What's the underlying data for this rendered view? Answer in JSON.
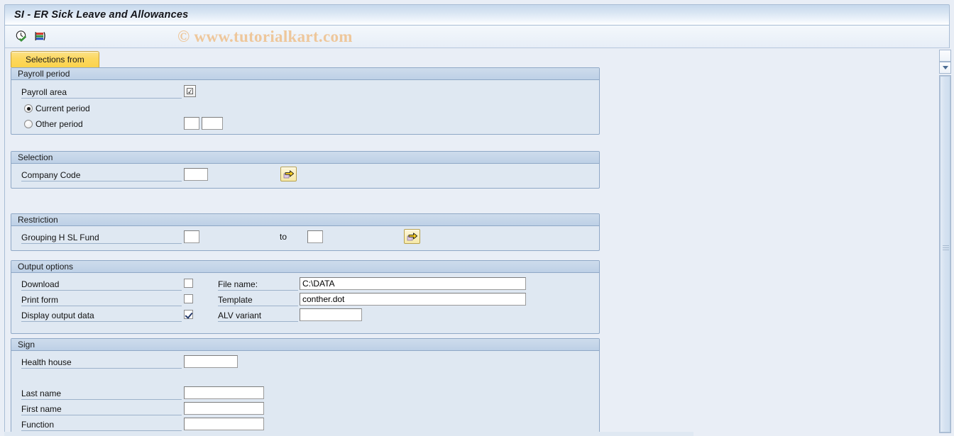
{
  "window": {
    "title": "SI - ER Sick Leave and Allowances"
  },
  "watermark": {
    "text": "© www.tutorialkart.com"
  },
  "toolbar": {
    "icons": [
      {
        "name": "execute-clock-icon",
        "title": "Execute"
      },
      {
        "name": "variant-bars-icon",
        "title": "Get Variant"
      }
    ]
  },
  "tabs": [
    {
      "label": "Selections from",
      "active": true
    }
  ],
  "groups": {
    "payroll_period": {
      "title": "Payroll period",
      "payroll_area_label": "Payroll area",
      "payroll_area_value": "",
      "matchcode_glyph": "☑",
      "current_period_label": "Current period",
      "other_period_label": "Other period",
      "current_period_selected": true,
      "other_period_value_1": "",
      "other_period_value_2": ""
    },
    "selection": {
      "title": "Selection",
      "company_code_label": "Company Code",
      "company_code_value": "",
      "multi_select_icon": "multi-select-arrow-icon"
    },
    "restriction": {
      "title": "Restriction",
      "grouping_label": "Grouping H SL Fund",
      "grouping_from_value": "",
      "to_label": "to",
      "grouping_to_value": "",
      "multi_select_icon": "multi-select-arrow-icon"
    },
    "output_options": {
      "title": "Output options",
      "download_label": "Download",
      "download_checked": false,
      "print_form_label": "Print form",
      "print_form_checked": false,
      "display_output_label": "Display output data",
      "display_output_checked": true,
      "file_name_label": "File name:",
      "file_name_value": "C:\\DATA",
      "template_label": "Template",
      "template_value": "conther.dot",
      "alv_variant_label": "ALV variant",
      "alv_variant_value": ""
    },
    "sign": {
      "title": "Sign",
      "health_house_label": "Health house",
      "health_house_value": "",
      "last_name_label": "Last name",
      "last_name_value": "",
      "first_name_label": "First name",
      "first_name_value": "",
      "function_label": "Function",
      "function_value": ""
    }
  },
  "colors": {
    "title_bar_start": "#c6d8ec",
    "page_background": "#e9eef6",
    "group_background": "#dfe8f2",
    "group_header": "#c3d4e8",
    "tab_yellow": "#fcd85f",
    "watermark": "#eec79b",
    "field_border": "#7d7d7d"
  }
}
